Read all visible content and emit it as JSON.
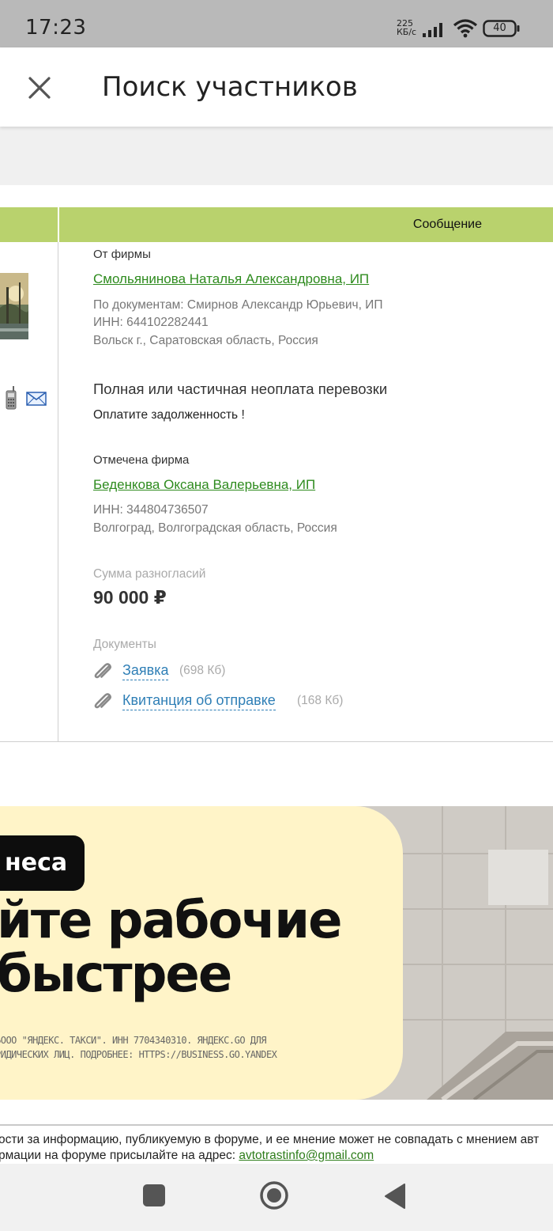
{
  "status_bar": {
    "time": "17:23",
    "net_speed_value": "225",
    "net_speed_unit": "КБ/с",
    "battery_level": "40"
  },
  "header": {
    "title": "Поиск участников"
  },
  "table": {
    "column_header": "Сообщение"
  },
  "message": {
    "from_label": "От фирмы",
    "from_company": "Смольянинова Наталья Александровна, ИП",
    "from_docs": "По документам: Смирнов Александр Юрьевич, ИП",
    "from_inn": "ИНН: 644102282441",
    "from_address": "Вольск г., Саратовская область, Россия",
    "subject": "Полная или частичная неоплата перевозки",
    "text": "Оплатите задолженность !",
    "marked_label": "Отмечена фирма",
    "marked_company": "Беденкова Оксана Валерьевна, ИП",
    "marked_inn": "ИНН: 344804736507",
    "marked_address": "Волгоград, Волгоградская область, Россия",
    "sum_label": "Сумма разногласий",
    "sum_value": "90 000 ₽",
    "docs_label": "Документы",
    "documents": [
      {
        "name": "Заявка",
        "size": "(698 Кб)"
      },
      {
        "name": "Квитанция об отправке",
        "size": "(168 Кб)"
      }
    ]
  },
  "banner": {
    "pill": "неса",
    "headline_line1": "йте рабочие",
    "headline_line2": "быстрее",
    "legal_line1": "ЬООО \"ЯНДЕКС. ТАКСИ\". ИНН 7704340310. ЯНДЕКС.GO ДЛЯ",
    "legal_line2": "РИДИЧЕСКИХ ЛИЦ. ПОДРОБНЕЕ: HTTPS://BUSINESS.GO.YANDEX"
  },
  "footer": {
    "line1": "ости за информацию, публикуемую в форуме, и ее мнение может не совпадать с мнением авт",
    "line2_prefix": "рмации на форуме присылайте на адрес: ",
    "email": "avtotrastinfo@gmail.com"
  },
  "colors": {
    "table_header": "#b9d26d",
    "link_green": "#2e8b1e",
    "doc_link_blue": "#2f7fb6",
    "banner_yellow": "#fff4c8"
  }
}
